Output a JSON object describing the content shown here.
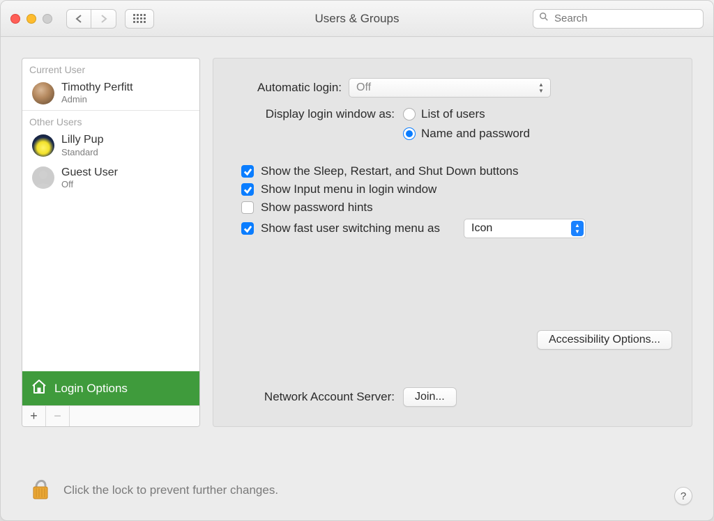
{
  "window": {
    "title": "Users & Groups",
    "search_placeholder": "Search"
  },
  "sidebar": {
    "current_label": "Current User",
    "other_label": "Other Users",
    "current": {
      "name": "Timothy Perfitt",
      "role": "Admin"
    },
    "others": [
      {
        "name": "Lilly Pup",
        "role": "Standard"
      },
      {
        "name": "Guest User",
        "role": "Off"
      }
    ],
    "login_options": "Login Options"
  },
  "panel": {
    "auto_login_label": "Automatic login:",
    "auto_login_value": "Off",
    "display_label": "Display login window as:",
    "radios": {
      "list": "List of users",
      "namepass": "Name and password"
    },
    "checks": {
      "sleep": "Show the Sleep, Restart, and Shut Down buttons",
      "input": "Show Input menu in login window",
      "hints": "Show password hints",
      "fast": "Show fast user switching menu as"
    },
    "fast_value": "Icon",
    "accessibility": "Accessibility Options...",
    "net_label": "Network Account Server:",
    "join": "Join..."
  },
  "footer": {
    "lock_text": "Click the lock to prevent further changes.",
    "help": "?"
  }
}
